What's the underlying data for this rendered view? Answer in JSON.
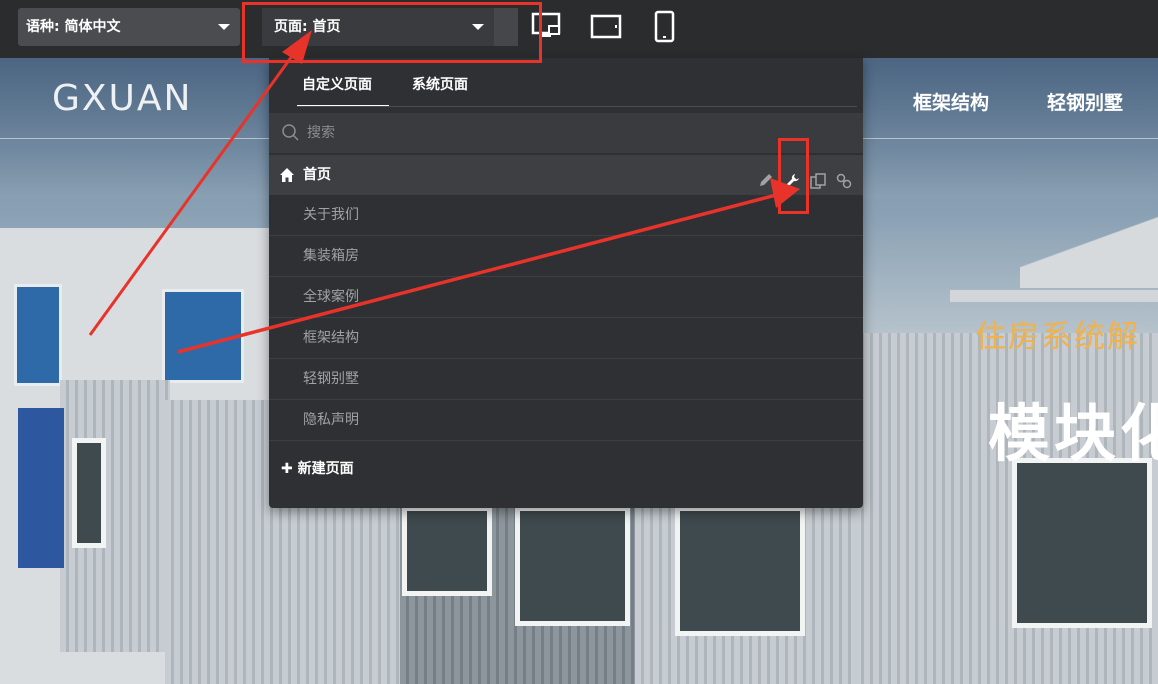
{
  "toolbar": {
    "language_label": "语种: 简体中文",
    "page_label": "页面: 首页",
    "devices": [
      "desktop-icon",
      "tablet-icon",
      "mobile-icon"
    ]
  },
  "site": {
    "logo": "GXUAN",
    "nav_fragment": "",
    "nav": [
      "框架结构",
      "轻钢别墅"
    ],
    "hero_subtitle": "住房系统解",
    "hero_title": "模块化"
  },
  "panel": {
    "tabs": [
      "自定义页面",
      "系统页面"
    ],
    "search_placeholder": "搜索",
    "home": "首页",
    "pages": [
      "关于我们",
      "集装箱房",
      "全球案例",
      "框架结构",
      "轻钢别墅",
      "隐私声明"
    ],
    "new_page": "新建页面"
  },
  "colors": {
    "annotation": "#e8332b",
    "panel_bg": "#2f3033",
    "hero_subtitle": "#f0b24a"
  }
}
